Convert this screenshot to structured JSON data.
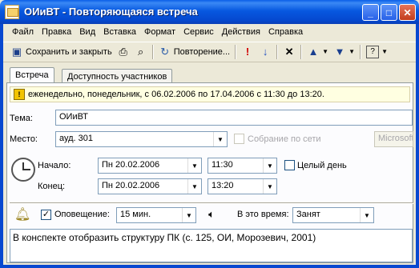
{
  "window": {
    "title": "ОИиВТ - Повторяющаяся встреча",
    "minimize": "_",
    "maximize": "□",
    "close": "✕"
  },
  "menu": [
    "Файл",
    "Правка",
    "Вид",
    "Вставка",
    "Формат",
    "Сервис",
    "Действия",
    "Справка"
  ],
  "toolbar": {
    "save_close": "Сохранить и закрыть",
    "recurrence": "Повторение..."
  },
  "tabs": [
    "Встреча",
    "Доступность участников"
  ],
  "info": "еженедельно, понедельник, с 06.02.2006 по 17.04.2006 с 11:30 до 13:20.",
  "subject": {
    "label": "Тема:",
    "value": "ОИиВТ"
  },
  "location": {
    "label": "Место:",
    "value": "ауд. 301",
    "online_label": "Собрание по сети",
    "online_value": "Microsoft"
  },
  "start": {
    "label": "Начало:",
    "date": "Пн 20.02.2006",
    "time": "11:30",
    "allday": "Целый день"
  },
  "end": {
    "label": "Конец:",
    "date": "Пн 20.02.2006",
    "time": "13:20"
  },
  "reminder": {
    "label": "Оповещение:",
    "value": "15 мин.",
    "checked": "✓"
  },
  "showas": {
    "label": "В это время:",
    "value": "Занят"
  },
  "notes": "В конспекте отобразить структуру ПК (с. 125, ОИ, Морозевич, 2001)"
}
